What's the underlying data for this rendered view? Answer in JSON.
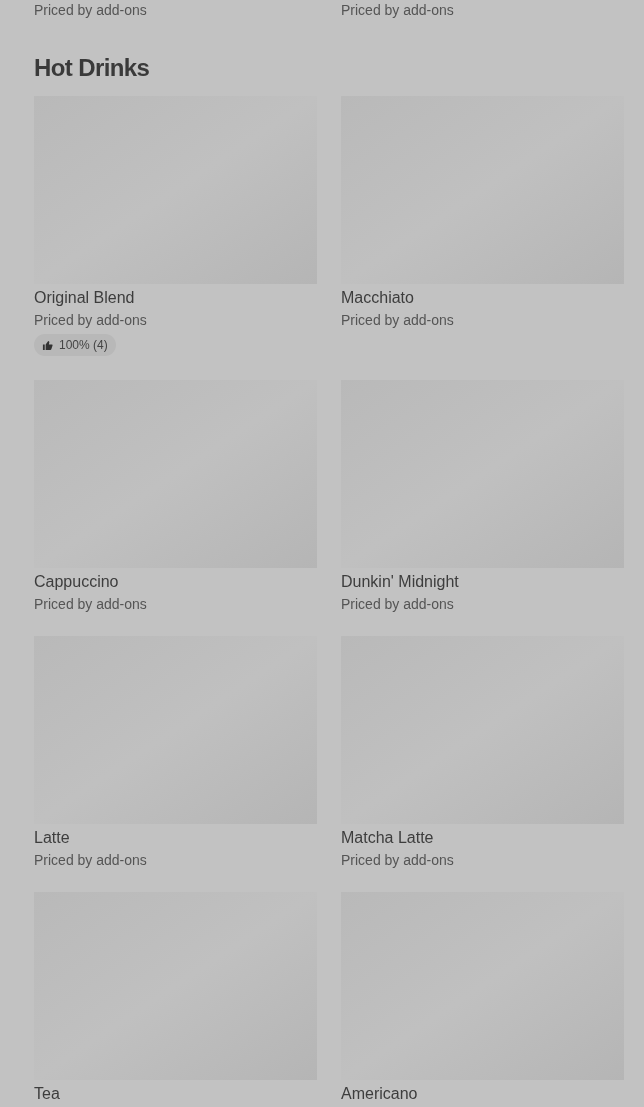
{
  "previous_section": {
    "items": [
      {
        "subtitle": "Priced by add-ons"
      },
      {
        "subtitle": "Priced by add-ons"
      }
    ]
  },
  "section": {
    "title": "Hot Drinks",
    "items": [
      {
        "name": "Original Blend",
        "subtitle": "Priced by add-ons",
        "rating": "100% (4)"
      },
      {
        "name": "Macchiato",
        "subtitle": "Priced by add-ons"
      },
      {
        "name": "Cappuccino",
        "subtitle": "Priced by add-ons"
      },
      {
        "name": "Dunkin' Midnight",
        "subtitle": "Priced by add-ons"
      },
      {
        "name": "Latte",
        "subtitle": "Priced by add-ons"
      },
      {
        "name": "Matcha Latte",
        "subtitle": "Priced by add-ons"
      },
      {
        "name": "Tea"
      },
      {
        "name": "Americano"
      }
    ]
  }
}
